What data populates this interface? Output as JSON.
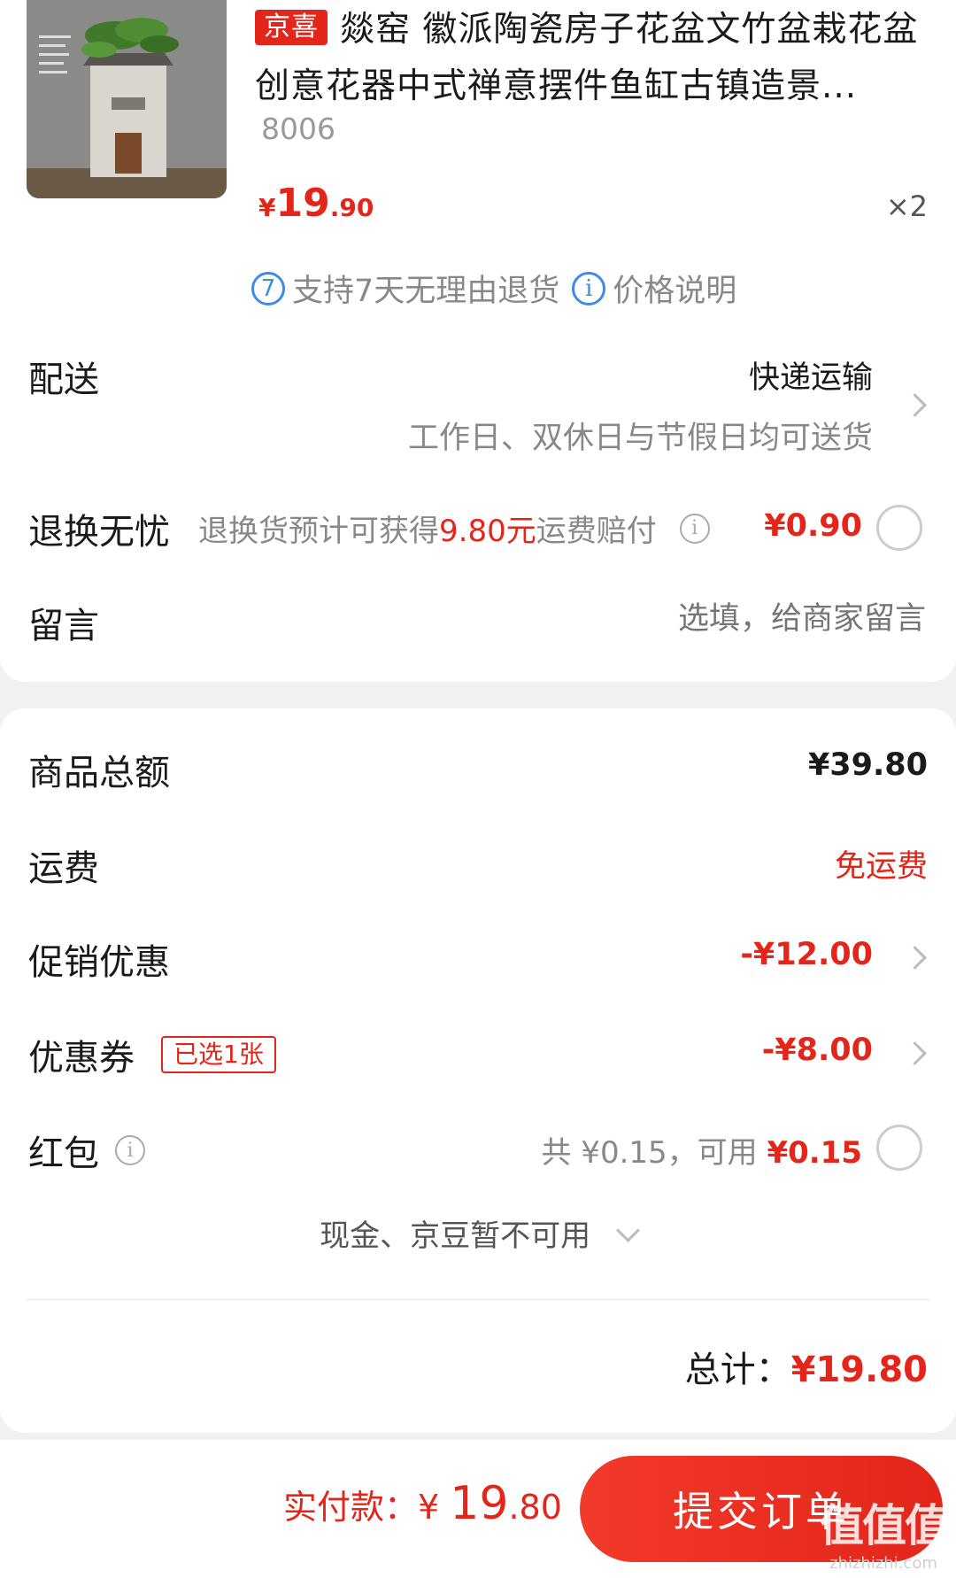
{
  "product": {
    "tag": "京喜",
    "title": "燚窑 徽派陶瓷房子花盆文竹盆栽花盆创意花器中式禅意摆件鱼缸古镇造景...",
    "sku": "8006",
    "price_symbol": "¥",
    "price_int": "19",
    "price_dec": ".90",
    "quantity": "×2",
    "service_return_num": "7",
    "service_return": "支持7天无理由退货",
    "service_price": "价格说明"
  },
  "delivery": {
    "label": "配送",
    "method": "快递运输",
    "note": "工作日、双休日与节假日均可送货"
  },
  "return_worry": {
    "label": "退换无忧",
    "desc_prefix": "退换货预计可获得",
    "desc_amount": "9.80元",
    "desc_suffix": "运费赔付",
    "price": "¥0.90"
  },
  "message": {
    "label": "留言",
    "placeholder": "选填，给商家留言"
  },
  "summary": {
    "goods_total_label": "商品总额",
    "goods_total": "¥39.80",
    "shipping_label": "运费",
    "shipping": "免运费",
    "promo_label": "促销优惠",
    "promo": "-¥12.00",
    "coupon_label": "优惠券",
    "coupon_badge": "已选1张",
    "coupon": "-¥8.00",
    "redpacket_label": "红包",
    "redpacket_total": "共 ¥0.15，可用 ",
    "redpacket_avail": "¥0.15",
    "cash_note": "现金、京豆暂不可用",
    "total_label": "总计：",
    "total": "¥19.80"
  },
  "footer": {
    "pay_label": "实付款：",
    "pay_yen": "¥",
    "pay_int": "19",
    "pay_dec": ".80",
    "submit": "提交订单",
    "watermark": "值值值",
    "watermark_site": "zhizhizhi.com"
  },
  "colors": {
    "accent": "#e3251a",
    "info_blue": "#3d8be8"
  }
}
